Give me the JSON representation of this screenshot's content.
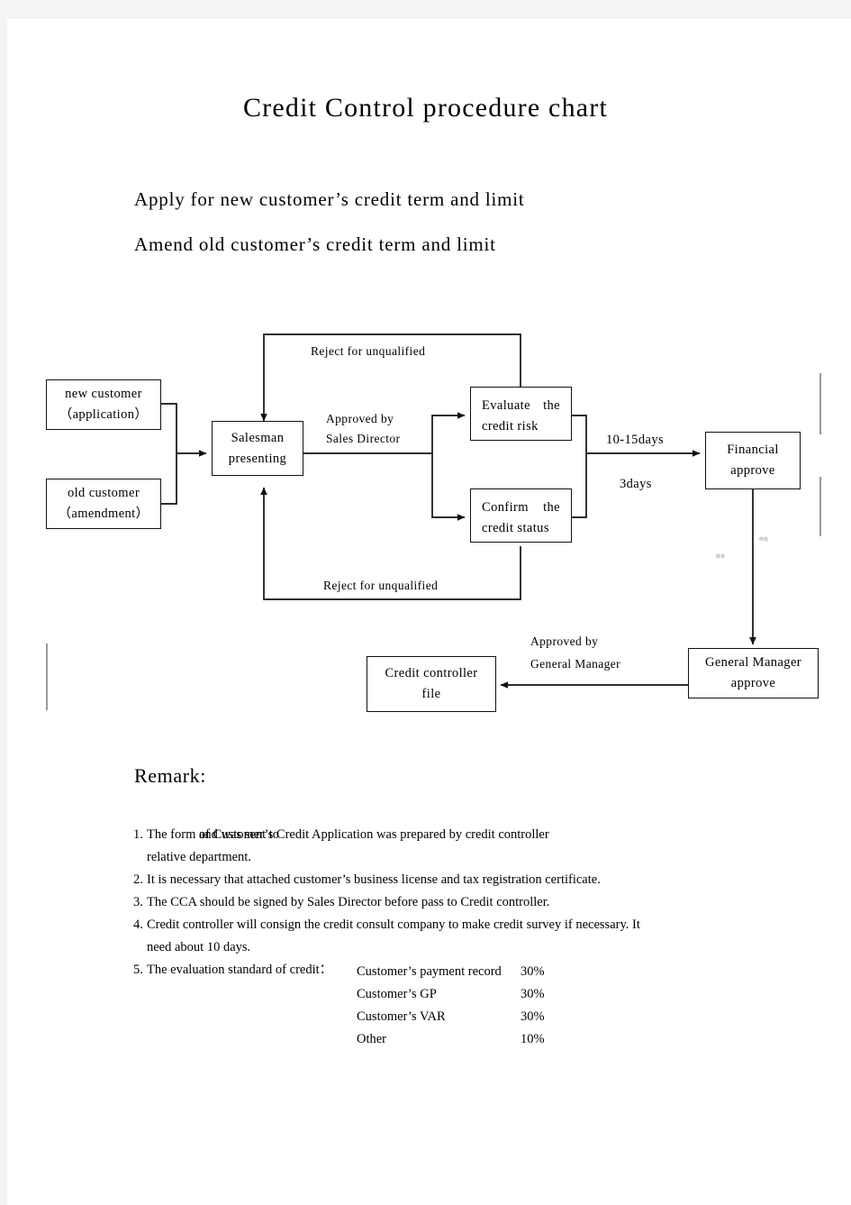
{
  "document": {
    "title": "Credit  Control  procedure  chart",
    "intro_lines": [
      "Apply  for  new  customer’s  credit  term  and  limit",
      "Amend  old  customer’s  credit  term  and  limit"
    ]
  },
  "flowchart": {
    "nodes": [
      {
        "id": "new-customer",
        "line1": "new  customer",
        "line2": "（application）"
      },
      {
        "id": "old-customer",
        "line1": "old  customer",
        "line2": "（amendment）"
      },
      {
        "id": "salesman",
        "line1": "Salesman",
        "line2": "presenting"
      },
      {
        "id": "evaluate-risk",
        "line1a": "Evaluate",
        "line1b": "the",
        "line2": "credit  risk"
      },
      {
        "id": "confirm-status",
        "line1a": "Confirm",
        "line1b": "the",
        "line2": "credit  status"
      },
      {
        "id": "financial-approve",
        "line1": "Financial",
        "line2": "approve"
      },
      {
        "id": "gm-approve",
        "line1": "General  Manager",
        "line2": "approve"
      },
      {
        "id": "credit-file",
        "line1": "Credit  controller",
        "line2": "file"
      }
    ],
    "edge_labels": {
      "reject_top": "Reject  for  unqualified",
      "reject_bottom": "Reject  for  unqualified",
      "approved_sales_1": "Approved  by",
      "approved_sales_2": "Sales  Director",
      "days_10_15": "10-15days",
      "days_3": "3days",
      "approved_gm_1": "Approved  by",
      "approved_gm_2": "General  Manager"
    },
    "artifacts": {
      "glyph_left": "转单",
      "glyph_right": "申批"
    }
  },
  "remark": {
    "heading": "Remark:",
    "items": [
      {
        "num": "1.",
        "text_before": "The  form  of  Customer’s  Credit  Application  was  prepared  by  credit  controller",
        "overlap": "and  was  sent  to",
        "text_second_line": "relative  department."
      },
      {
        "num": "2.",
        "text": "It  is  necessary  that  attached  customer’s  business  license  and  tax  registration  certificate."
      },
      {
        "num": "3.",
        "text": "The  CCA  should  be  signed  by  Sales  Director  before  pass  to  Credit  controller."
      },
      {
        "num": "4.",
        "text": "Credit  controller  will  consign  the  credit  consult  company  to  make  credit  survey  if  necessary.  It",
        "text_second_line": "need  about  10  days."
      },
      {
        "num": "5.",
        "text": "The  evaluation  standard  of  credit："
      }
    ],
    "standard_table": {
      "rows": [
        {
          "name": "Customer’s  payment  record",
          "pct": "30%"
        },
        {
          "name": "Customer’s  GP",
          "pct": "30%"
        },
        {
          "name": "Customer’s  VAR",
          "pct": "30%"
        },
        {
          "name": "Other",
          "pct": "10%"
        }
      ]
    }
  },
  "colors": {
    "ink": "#111111",
    "paper": "#ffffff",
    "margin_bar": "#9a9a9a",
    "scan_edge": "#f4f4f4"
  }
}
